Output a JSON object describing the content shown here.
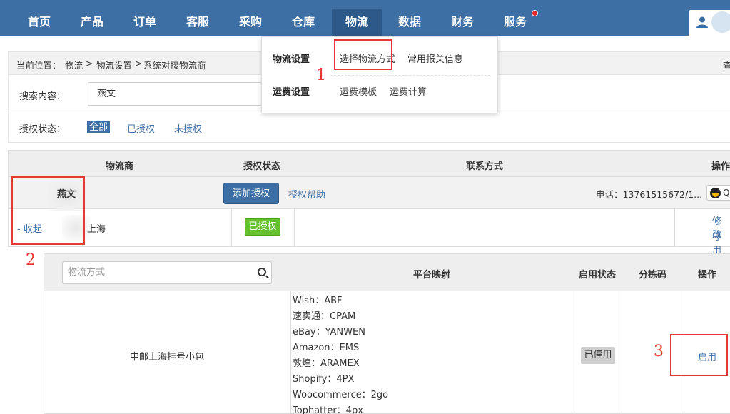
{
  "nav": {
    "items": [
      {
        "label": "首页"
      },
      {
        "label": "产品"
      },
      {
        "label": "订单"
      },
      {
        "label": "客服"
      },
      {
        "label": "采购"
      },
      {
        "label": "仓库"
      },
      {
        "label": "物流"
      },
      {
        "label": "数据"
      },
      {
        "label": "财务"
      },
      {
        "label": "服务"
      }
    ],
    "active": "物流"
  },
  "dropdown": {
    "group1": {
      "title": "物流设置",
      "links": [
        "选择物流方式",
        "常用报关信息"
      ]
    },
    "group2": {
      "title": "运费设置",
      "links": [
        "运费模板",
        "运费计算"
      ]
    }
  },
  "breadcrumb": {
    "prefix": "当前位置：",
    "items": [
      "物流",
      ">",
      "物流设置",
      ">",
      "系统对接物流商"
    ],
    "right_text": "查"
  },
  "filter": {
    "search_label": "搜索内容：",
    "search_value": "燕文",
    "status_label": "授权状态：",
    "status_options": [
      "全部",
      "已授权",
      "未授权"
    ]
  },
  "table": {
    "headers": {
      "carrier": "物流商",
      "auth_status": "授权状态",
      "contact": "联系方式",
      "ops": "操作"
    }
  },
  "carrier": {
    "name": "燕文",
    "add_auth_label": "添加授权",
    "auth_help_label": "授权帮助",
    "phone": "电话：13761515672/1...",
    "qq_label": "Q"
  },
  "detail": {
    "collapse_label": "- 收起",
    "city": "上海",
    "auth_badge": "已授权",
    "edit_label": "修改",
    "disable_label": "停用"
  },
  "sub_table": {
    "search_placeholder": "物流方式",
    "headers": {
      "mapping": "平台映射",
      "enable_status": "启用状态",
      "sort_code": "分拣码",
      "ops": "操作"
    },
    "method_name": "中邮上海挂号小包",
    "mappings": [
      "Wish：ABF",
      "速卖通：CPAM",
      "eBay：YANWEN",
      "Amazon：EMS",
      "敦煌：ARAMEX",
      "Shopify：4PX",
      "Woocommerce：2go",
      "Tophatter：4px"
    ],
    "status_badge": "已停用",
    "enable_label": "启用"
  },
  "annotations": [
    "1",
    "2",
    "3"
  ],
  "colors": {
    "primary": "#3d6fa5",
    "nav_active": "#2d5989",
    "success": "#65c12c",
    "annotation": "#e53935"
  }
}
